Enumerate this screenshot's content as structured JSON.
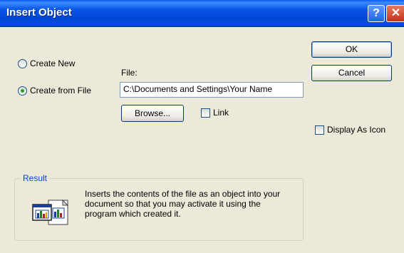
{
  "window": {
    "title": "Insert Object"
  },
  "titlebar": {
    "help_glyph": "?",
    "close_glyph": "✕"
  },
  "options": {
    "create_new_label": "Create New",
    "create_from_file_label": "Create from File",
    "selected": "create_from_file"
  },
  "file": {
    "label": "File:",
    "value": "C:\\Documents and Settings\\Your Name",
    "browse_label": "Browse...",
    "link_label": "Link",
    "link_checked": false
  },
  "actions": {
    "ok_label": "OK",
    "cancel_label": "Cancel"
  },
  "display_as_icon": {
    "label": "Display As Icon",
    "checked": false
  },
  "result": {
    "legend": "Result",
    "text": "Inserts the contents of the file as an object into your document so that you may activate it using the program which created it.",
    "icon": "insert-file-object-icon"
  },
  "colors": {
    "titlebar": "#0a4cd9",
    "dialog_bg": "#ece9d8",
    "legend": "#0046d5"
  }
}
